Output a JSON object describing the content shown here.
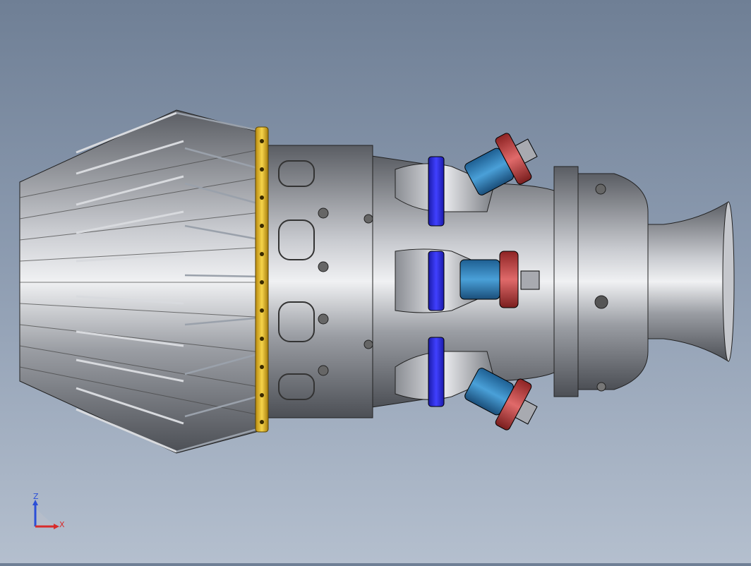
{
  "viewport": {
    "background_top": "#6f7f95",
    "background_bottom": "#b4bfce"
  },
  "model": {
    "body_color": "#8a8d93",
    "ring_color": "#e8b81c",
    "flange_blue": "#2f2fd6",
    "injector_blue": "#2a7bb8",
    "injector_red": "#c23a3a"
  },
  "triad": {
    "z_label": "Z",
    "x_label": "X",
    "z_color": "#2b4fd8",
    "x_color": "#d82b2b"
  }
}
